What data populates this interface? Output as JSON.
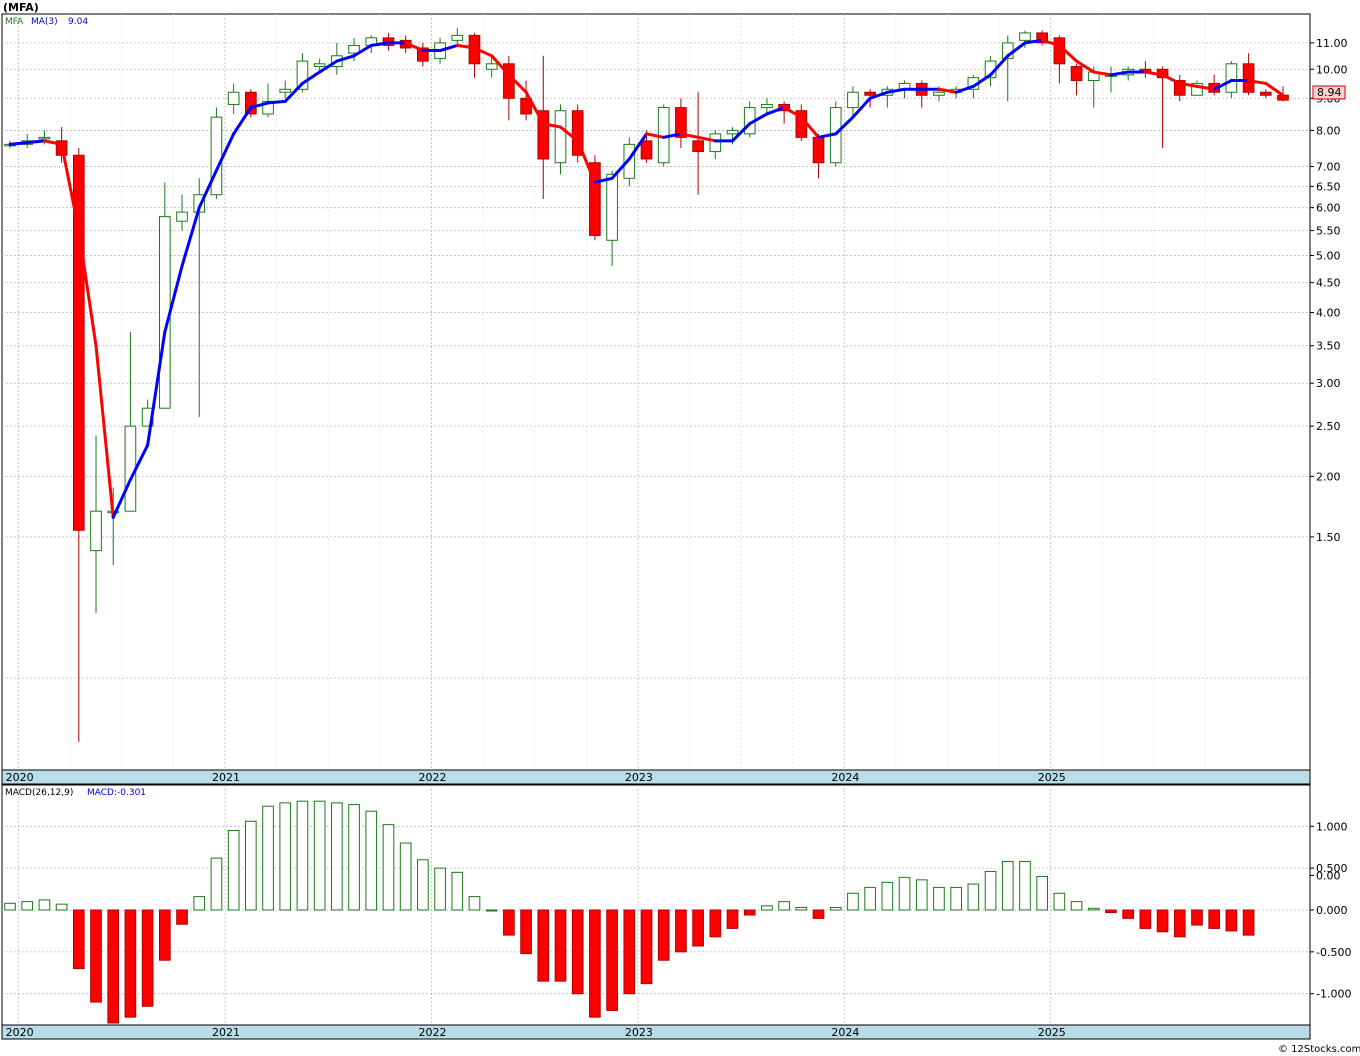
{
  "title": "(MFA)",
  "watermark": "© 12Stocks.com",
  "colors": {
    "up": "#1a7a1a",
    "down": "#ff0000",
    "ma_up": "#0000ff",
    "ma_down": "#ff0000",
    "axis_band": "#b8dce8",
    "grid": "#bbbbbb",
    "price_tag": "#ffd0d0"
  },
  "price_panel": {
    "legend": {
      "symbol": "MFA",
      "ma_label": "MA(3)",
      "ma_value": "9.04"
    },
    "last_price_label": "8.94",
    "y_tick_labels": [
      "11.00",
      "10.00",
      "9.00",
      "8.00",
      "7.00",
      "6.50",
      "6.00",
      "5.50",
      "5.00",
      "4.50",
      "4.00",
      "3.50",
      "3.00",
      "2.50",
      "2.00",
      "1.50",
      "0.00"
    ]
  },
  "macd_panel": {
    "legend": {
      "label": "MACD(26,12,9)",
      "value_label": "MACD:-0.301"
    },
    "y_tick_labels": [
      "1.000",
      "0.500",
      "0.000",
      "-0.500",
      "-1.000"
    ]
  },
  "x_axis": {
    "year_labels": [
      "2020",
      "2021",
      "2022",
      "2023",
      "2024",
      "2025"
    ]
  },
  "chart_data": [
    {
      "type": "candlestick",
      "title": "(MFA)",
      "interval": "monthly",
      "start_month": "2019-12",
      "y_scale": "log",
      "candles": [
        [
          7.6,
          7.7,
          7.5,
          7.6
        ],
        [
          7.6,
          7.9,
          7.5,
          7.7
        ],
        [
          7.8,
          8.0,
          7.6,
          7.8
        ],
        [
          7.7,
          8.1,
          7.1,
          7.3
        ],
        [
          7.3,
          7.5,
          0.4,
          1.55
        ],
        [
          1.4,
          2.4,
          1.0,
          1.7
        ],
        [
          1.7,
          1.9,
          1.3,
          1.7
        ],
        [
          1.7,
          3.7,
          1.7,
          2.5
        ],
        [
          2.5,
          2.8,
          2.5,
          2.7
        ],
        [
          2.7,
          6.6,
          2.7,
          5.8
        ],
        [
          5.7,
          6.3,
          5.5,
          5.9
        ],
        [
          5.9,
          6.7,
          2.6,
          6.3
        ],
        [
          6.3,
          8.7,
          6.2,
          8.4
        ],
        [
          8.8,
          9.5,
          8.5,
          9.2
        ],
        [
          9.2,
          9.3,
          8.4,
          8.5
        ],
        [
          8.5,
          9.5,
          8.4,
          8.9
        ],
        [
          9.2,
          9.6,
          9.0,
          9.3
        ],
        [
          9.3,
          10.6,
          9.2,
          10.3
        ],
        [
          10.1,
          10.4,
          9.9,
          10.2
        ],
        [
          10.1,
          11.0,
          9.8,
          10.5
        ],
        [
          10.6,
          11.2,
          10.3,
          10.9
        ],
        [
          10.9,
          11.3,
          10.6,
          11.2
        ],
        [
          11.2,
          11.4,
          10.7,
          10.9
        ],
        [
          11.1,
          11.3,
          10.6,
          10.8
        ],
        [
          10.8,
          11.0,
          10.1,
          10.3
        ],
        [
          10.4,
          11.2,
          10.2,
          11.0
        ],
        [
          11.1,
          11.6,
          10.9,
          11.3
        ],
        [
          11.3,
          11.4,
          9.7,
          10.2
        ],
        [
          10.0,
          10.5,
          9.7,
          10.2
        ],
        [
          10.2,
          10.5,
          8.3,
          9.0
        ],
        [
          9.0,
          9.6,
          8.3,
          8.5
        ],
        [
          8.6,
          10.5,
          6.2,
          7.2
        ],
        [
          7.1,
          8.8,
          6.8,
          8.6
        ],
        [
          8.6,
          8.8,
          7.1,
          7.3
        ],
        [
          7.1,
          7.3,
          5.3,
          5.4
        ],
        [
          5.3,
          6.9,
          4.8,
          6.8
        ],
        [
          6.7,
          7.8,
          6.5,
          7.6
        ],
        [
          7.7,
          8.0,
          7.1,
          7.2
        ],
        [
          7.1,
          8.8,
          7.0,
          8.7
        ],
        [
          8.7,
          9.0,
          7.5,
          7.8
        ],
        [
          7.7,
          9.2,
          6.3,
          7.4
        ],
        [
          7.4,
          8.0,
          7.2,
          7.9
        ],
        [
          7.9,
          8.1,
          7.6,
          8.0
        ],
        [
          7.9,
          8.9,
          7.8,
          8.7
        ],
        [
          8.7,
          9.0,
          8.5,
          8.8
        ],
        [
          8.8,
          8.9,
          8.2,
          8.6
        ],
        [
          8.6,
          8.8,
          7.7,
          7.8
        ],
        [
          7.8,
          7.9,
          6.7,
          7.1
        ],
        [
          7.1,
          8.9,
          7.0,
          8.7
        ],
        [
          8.7,
          9.4,
          8.4,
          9.2
        ],
        [
          9.2,
          9.3,
          8.7,
          9.1
        ],
        [
          9.1,
          9.4,
          8.7,
          9.3
        ],
        [
          9.3,
          9.6,
          9.0,
          9.5
        ],
        [
          9.5,
          9.6,
          8.7,
          9.1
        ],
        [
          9.1,
          9.4,
          8.9,
          9.2
        ],
        [
          9.2,
          9.4,
          9.0,
          9.3
        ],
        [
          9.3,
          9.8,
          9.0,
          9.7
        ],
        [
          9.7,
          10.5,
          9.4,
          10.3
        ],
        [
          10.4,
          11.3,
          8.9,
          11.0
        ],
        [
          11.1,
          11.5,
          10.8,
          11.4
        ],
        [
          11.4,
          11.5,
          10.9,
          11.0
        ],
        [
          11.2,
          11.3,
          9.5,
          10.2
        ],
        [
          10.1,
          10.2,
          9.1,
          9.6
        ],
        [
          9.6,
          10.1,
          8.7,
          9.9
        ],
        [
          9.8,
          10.1,
          9.2,
          9.8
        ],
        [
          9.8,
          10.1,
          9.6,
          10.0
        ],
        [
          10.0,
          10.3,
          9.7,
          9.9
        ],
        [
          10.0,
          10.1,
          7.5,
          9.7
        ],
        [
          9.6,
          9.8,
          8.9,
          9.1
        ],
        [
          9.1,
          9.6,
          9.1,
          9.5
        ],
        [
          9.5,
          9.8,
          9.1,
          9.2
        ],
        [
          9.2,
          10.3,
          9.0,
          10.2
        ],
        [
          10.2,
          10.6,
          9.1,
          9.2
        ],
        [
          9.2,
          9.3,
          9.0,
          9.1
        ],
        [
          9.1,
          9.4,
          8.9,
          8.94
        ]
      ],
      "moving_average": {
        "name": "MA(3)",
        "values": [
          7.6,
          7.65,
          7.7,
          7.6,
          5.5,
          3.5,
          1.65,
          1.97,
          2.3,
          3.7,
          4.8,
          6.0,
          6.9,
          7.9,
          8.7,
          8.85,
          8.9,
          9.5,
          9.9,
          10.3,
          10.5,
          10.9,
          11.0,
          11.0,
          10.7,
          10.7,
          10.9,
          10.8,
          10.5,
          9.8,
          9.2,
          8.2,
          8.1,
          7.7,
          6.6,
          6.7,
          7.2,
          7.9,
          7.8,
          7.9,
          7.8,
          7.7,
          7.7,
          8.2,
          8.5,
          8.7,
          8.4,
          7.8,
          7.9,
          8.4,
          9.0,
          9.2,
          9.3,
          9.3,
          9.3,
          9.2,
          9.4,
          9.8,
          10.5,
          11.0,
          11.1,
          10.9,
          10.3,
          9.9,
          9.8,
          9.9,
          9.9,
          9.8,
          9.5,
          9.4,
          9.3,
          9.6,
          9.6,
          9.5,
          9.1
        ]
      }
    },
    {
      "type": "bar",
      "title": "MACD(26,12,9)",
      "interval": "monthly",
      "start_month": "2019-12",
      "ylim": [
        -1.35,
        1.35
      ],
      "values": [
        0.08,
        0.1,
        0.12,
        0.07,
        -0.7,
        -1.1,
        -1.35,
        -1.28,
        -1.15,
        -0.6,
        -0.17,
        0.16,
        0.62,
        0.95,
        1.06,
        1.24,
        1.28,
        1.3,
        1.3,
        1.28,
        1.26,
        1.18,
        1.02,
        0.8,
        0.6,
        0.5,
        0.45,
        0.16,
        0.0,
        -0.3,
        -0.52,
        -0.85,
        -0.85,
        -1.0,
        -1.28,
        -1.2,
        -1.0,
        -0.88,
        -0.6,
        -0.5,
        -0.43,
        -0.32,
        -0.22,
        -0.06,
        0.05,
        0.1,
        0.03,
        -0.1,
        0.03,
        0.2,
        0.27,
        0.33,
        0.39,
        0.36,
        0.27,
        0.27,
        0.31,
        0.46,
        0.58,
        0.58,
        0.4,
        0.2,
        0.1,
        0.02,
        -0.03,
        -0.1,
        -0.22,
        -0.26,
        -0.32,
        -0.18,
        -0.22,
        -0.25,
        -0.3
      ]
    }
  ]
}
